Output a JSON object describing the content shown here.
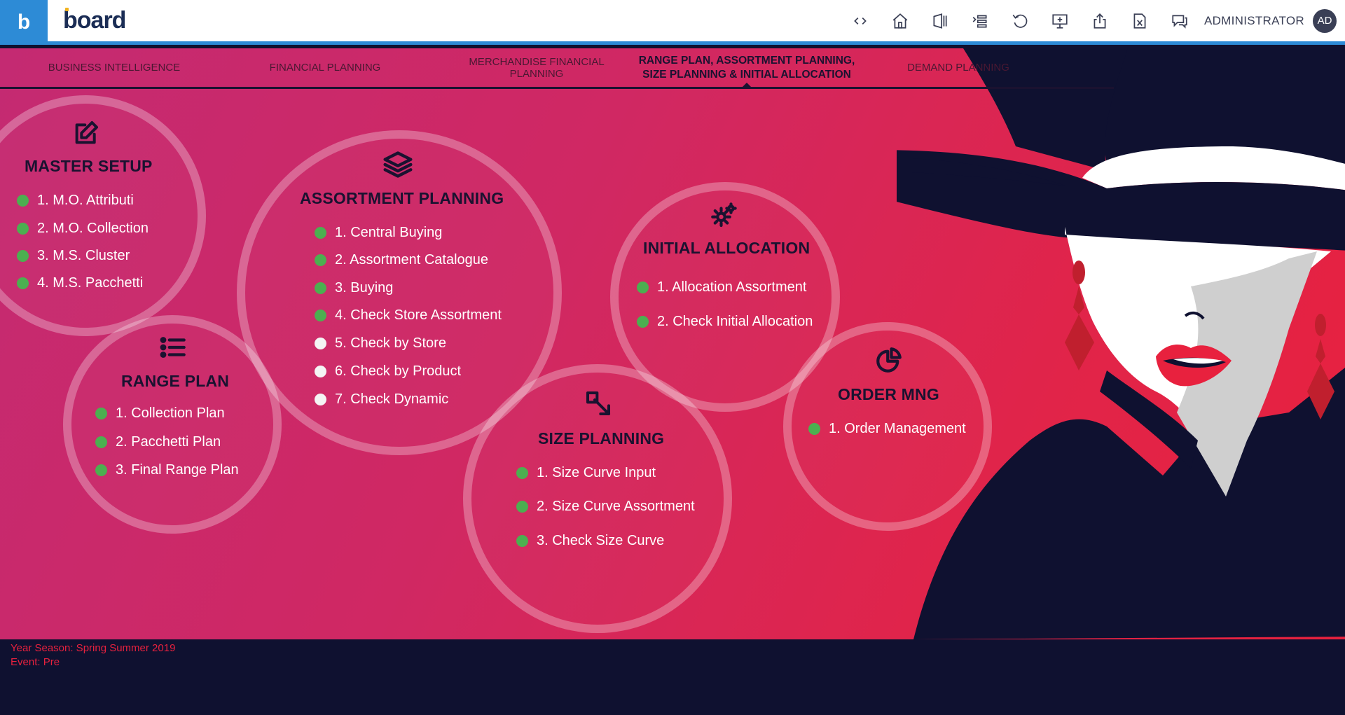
{
  "app": {
    "logo_letter": "b",
    "brand": "board"
  },
  "toolbar": {
    "user_name": "ADMINISTRATOR",
    "user_initials": "AD",
    "icons": [
      "code-icon",
      "home-icon",
      "panel-icon",
      "outline-icon",
      "refresh-icon",
      "presentation-icon",
      "share-icon",
      "excel-icon",
      "chat-icon"
    ]
  },
  "nav": {
    "tabs": [
      {
        "label": "BUSINESS INTELLIGENCE"
      },
      {
        "label": "FINANCIAL PLANNING"
      },
      {
        "label": "MERCHANDISE FINANCIAL PLANNING"
      },
      {
        "label": "RANGE PLAN, ASSORTMENT PLANNING, SIZE PLANNING & INITIAL ALLOCATION",
        "active": true
      },
      {
        "label": "DEMAND PLANNING"
      }
    ]
  },
  "modules": {
    "master_setup": {
      "title": "MASTER SETUP",
      "icon": "edit-icon",
      "items": [
        {
          "label": "1. M.O. Attributi",
          "status": "green"
        },
        {
          "label": "2. M.O. Collection",
          "status": "green"
        },
        {
          "label": "3. M.S. Cluster",
          "status": "green"
        },
        {
          "label": "4. M.S. Pacchetti",
          "status": "green"
        }
      ]
    },
    "range_plan": {
      "title": "RANGE PLAN",
      "icon": "list-icon",
      "items": [
        {
          "label": "1. Collection Plan",
          "status": "green"
        },
        {
          "label": "2. Pacchetti Plan",
          "status": "green"
        },
        {
          "label": "3. Final Range Plan",
          "status": "green"
        }
      ]
    },
    "assortment_planning": {
      "title": "ASSORTMENT PLANNING",
      "icon": "layers-icon",
      "items": [
        {
          "label": "1. Central Buying",
          "status": "green"
        },
        {
          "label": "2. Assortment Catalogue",
          "status": "green"
        },
        {
          "label": "3. Buying",
          "status": "green"
        },
        {
          "label": "4. Check Store Assortment",
          "status": "green"
        },
        {
          "label": "5. Check by Store",
          "status": "white"
        },
        {
          "label": "6. Check by Product",
          "status": "white"
        },
        {
          "label": "7. Check Dynamic",
          "status": "white"
        }
      ]
    },
    "size_planning": {
      "title": "SIZE PLANNING",
      "icon": "resize-icon",
      "items": [
        {
          "label": "1. Size Curve Input",
          "status": "green"
        },
        {
          "label": "2. Size Curve Assortment",
          "status": "green"
        },
        {
          "label": "3. Check Size Curve",
          "status": "green"
        }
      ]
    },
    "initial_allocation": {
      "title": "INITIAL ALLOCATION",
      "icon": "gears-icon",
      "items": [
        {
          "label": "1. Allocation Assortment",
          "status": "green"
        },
        {
          "label": "2. Check Initial Allocation",
          "status": "green"
        }
      ]
    },
    "order_mng": {
      "title": "ORDER MNG",
      "icon": "pie-icon",
      "items": [
        {
          "label": "1. Order Management",
          "status": "green"
        }
      ]
    }
  },
  "footer": {
    "season": "Year Season: Spring Summer 2019",
    "event": "Event: Pre"
  },
  "colors": {
    "accent_blue": "#2d8bd6",
    "navy": "#0f1130",
    "pink": "#c42a72",
    "red": "#e8213e",
    "status_green": "#4caf50"
  }
}
